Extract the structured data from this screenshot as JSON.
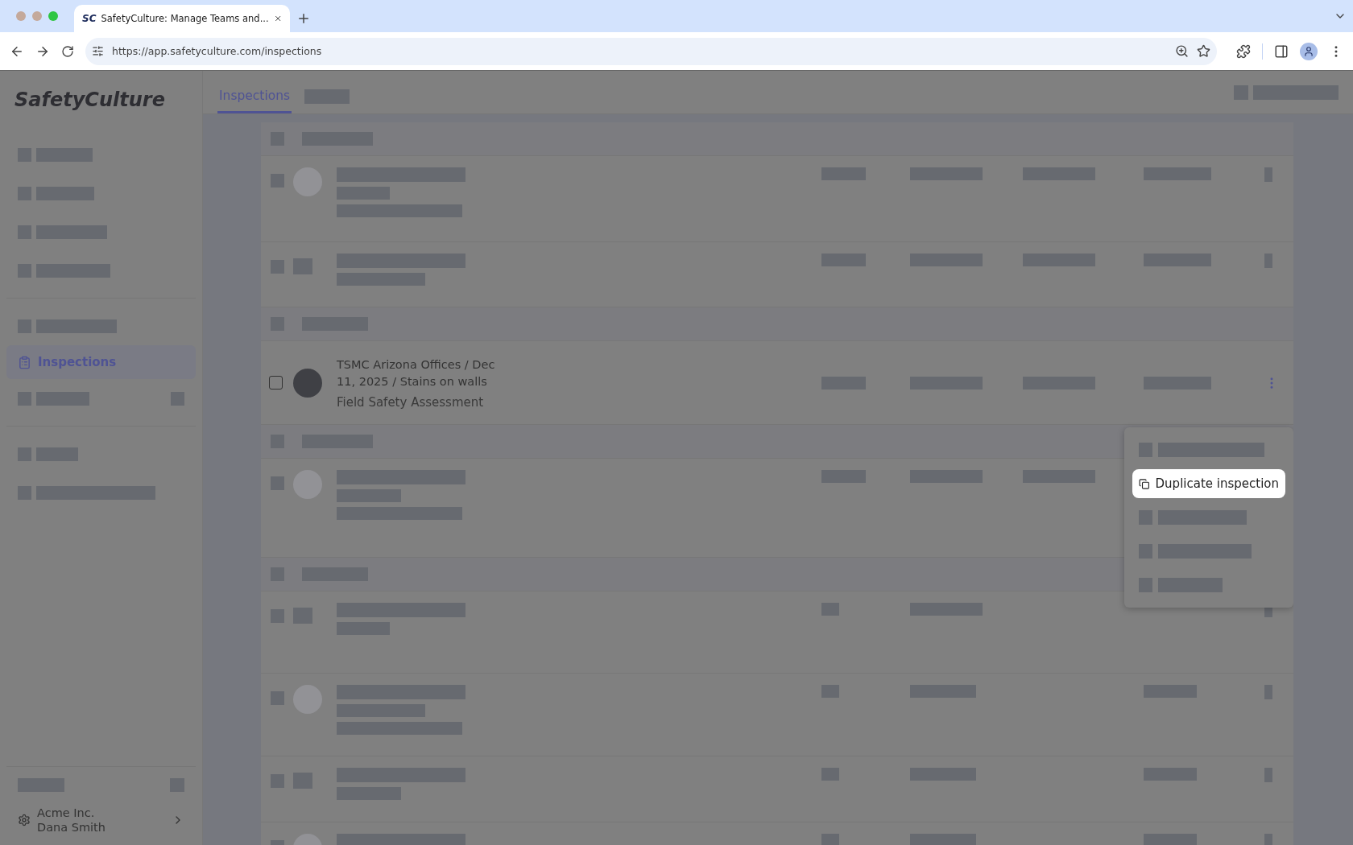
{
  "browser": {
    "favicon_text": "SC",
    "tab_title": "SafetyCulture: Manage Teams and...",
    "url": "https://app.safetyculture.com/inspections"
  },
  "sidebar": {
    "logo": "SafetyCulture",
    "items": [
      {
        "kind": "placeholder"
      },
      {
        "kind": "placeholder"
      },
      {
        "kind": "placeholder"
      },
      {
        "kind": "placeholder"
      },
      {
        "kind": "divider"
      },
      {
        "kind": "placeholder"
      },
      {
        "kind": "nav",
        "label": "Inspections",
        "selected": true
      },
      {
        "kind": "placeholder"
      },
      {
        "kind": "divider"
      },
      {
        "kind": "placeholder"
      },
      {
        "kind": "placeholder"
      }
    ],
    "account": {
      "organization": "Acme Inc.",
      "user": "Dana Smith"
    }
  },
  "tabs": [
    {
      "kind": "tab",
      "label": "Inspections",
      "selected": true
    },
    {
      "kind": "placeholder"
    }
  ],
  "rows": [
    {
      "kind": "group"
    },
    {
      "kind": "placeholder"
    },
    {
      "kind": "placeholder"
    },
    {
      "kind": "group"
    },
    {
      "kind": "item",
      "title": "TSMC Arizona Offices / Dec 11, 2025 / Stains on walls",
      "subtitle": "Field Safety Assessment",
      "checked": false
    },
    {
      "kind": "group"
    },
    {
      "kind": "placeholder"
    },
    {
      "kind": "group"
    },
    {
      "kind": "placeholder"
    },
    {
      "kind": "placeholder"
    },
    {
      "kind": "placeholder"
    },
    {
      "kind": "placeholder"
    }
  ],
  "menu": {
    "items": [
      {
        "kind": "placeholder",
        "selected": false
      },
      {
        "kind": "action",
        "label": "Duplicate inspection",
        "selected": true
      },
      {
        "kind": "placeholder",
        "selected": false
      },
      {
        "kind": "placeholder",
        "selected": false
      },
      {
        "kind": "placeholder",
        "selected": false
      }
    ]
  }
}
